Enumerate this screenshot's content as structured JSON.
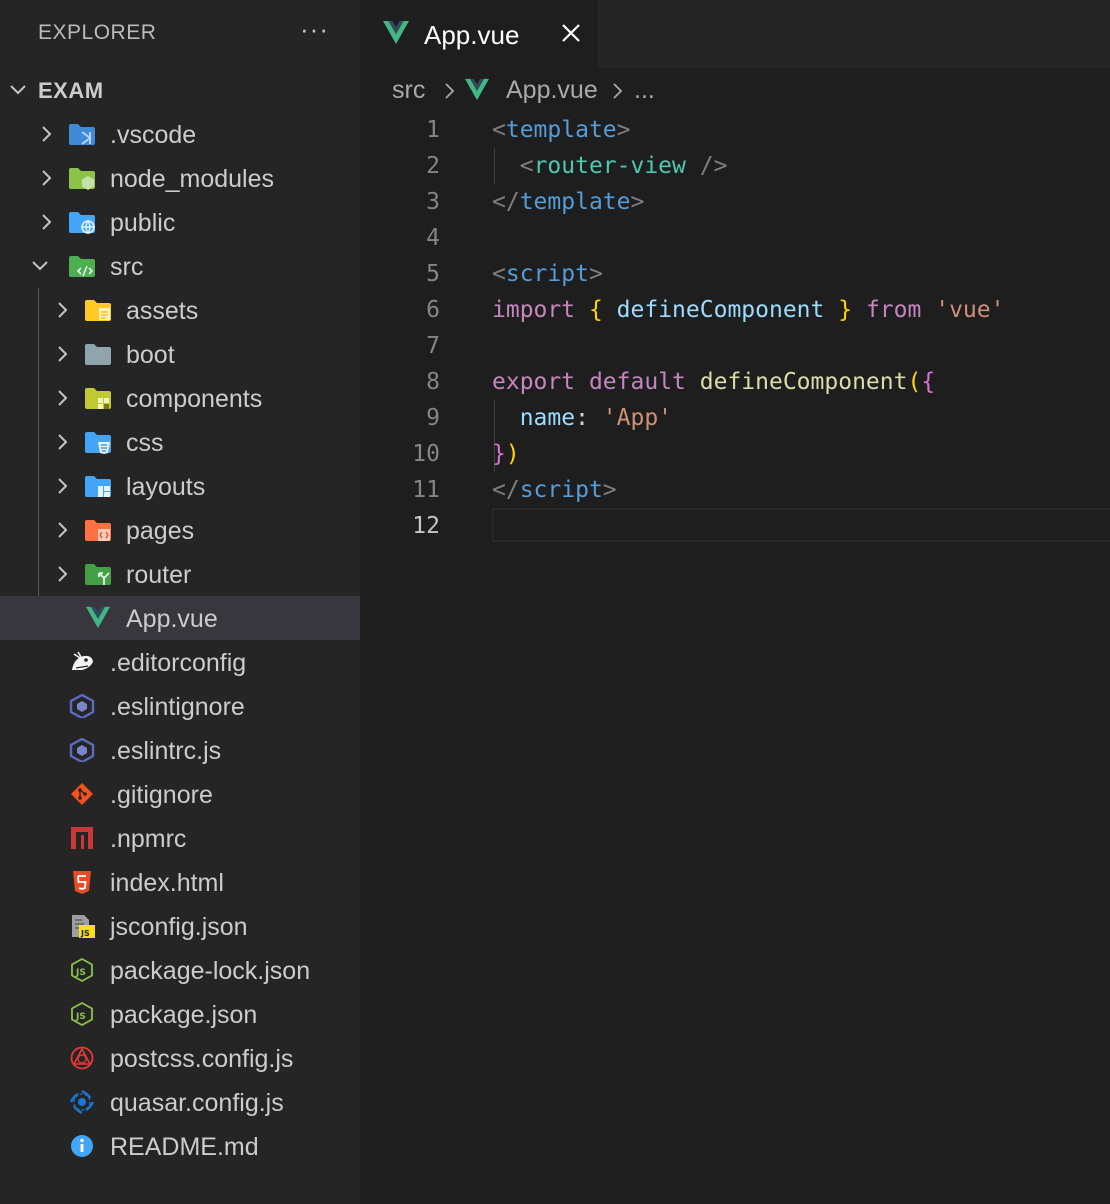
{
  "sidebar": {
    "title": "EXPLORER",
    "more": "···",
    "root": {
      "label": "EXAM",
      "expanded": true
    },
    "items": [
      {
        "label": ".vscode",
        "type": "folder",
        "icon": "vscode-folder-icon",
        "color": "#3f8ad6"
      },
      {
        "label": "node_modules",
        "type": "folder",
        "icon": "node-folder-icon",
        "color": "#8bc34a"
      },
      {
        "label": "public",
        "type": "folder",
        "icon": "public-folder-icon",
        "color": "#42a5f5"
      },
      {
        "label": "src",
        "type": "folder",
        "icon": "src-folder-icon",
        "color": "#4caf50",
        "expanded": true
      },
      {
        "label": "assets",
        "type": "folder",
        "icon": "assets-folder-icon",
        "color": "#ffca28"
      },
      {
        "label": "boot",
        "type": "folder",
        "icon": "boot-folder-icon",
        "color": "#90a4ae"
      },
      {
        "label": "components",
        "type": "folder",
        "icon": "components-folder-icon",
        "color": "#c0ca33"
      },
      {
        "label": "css",
        "type": "folder",
        "icon": "css-folder-icon",
        "color": "#42a5f5"
      },
      {
        "label": "layouts",
        "type": "folder",
        "icon": "layouts-folder-icon",
        "color": "#42a5f5"
      },
      {
        "label": "pages",
        "type": "folder",
        "icon": "pages-folder-icon",
        "color": "#ff7043"
      },
      {
        "label": "router",
        "type": "folder",
        "icon": "router-folder-icon",
        "color": "#43a047"
      },
      {
        "label": "App.vue",
        "type": "file",
        "icon": "vue-icon",
        "color": "#41b883",
        "selected": true
      },
      {
        "label": ".editorconfig",
        "type": "file",
        "icon": "editorconfig-icon",
        "color": "#ffffff"
      },
      {
        "label": ".eslintignore",
        "type": "file",
        "icon": "eslint-icon",
        "color": "#5c6bc0"
      },
      {
        "label": ".eslintrc.js",
        "type": "file",
        "icon": "eslint-icon",
        "color": "#5c6bc0"
      },
      {
        "label": ".gitignore",
        "type": "file",
        "icon": "git-icon",
        "color": "#f4511e"
      },
      {
        "label": ".npmrc",
        "type": "file",
        "icon": "npm-icon",
        "color": "#cb3837"
      },
      {
        "label": "index.html",
        "type": "file",
        "icon": "html-icon",
        "color": "#e44d26"
      },
      {
        "label": "jsconfig.json",
        "type": "file",
        "icon": "jsconfig-icon",
        "color": "#f7df1e"
      },
      {
        "label": "package-lock.json",
        "type": "file",
        "icon": "nodejs-icon",
        "color": "#8bc34a"
      },
      {
        "label": "package.json",
        "type": "file",
        "icon": "nodejs-icon",
        "color": "#8bc34a"
      },
      {
        "label": "postcss.config.js",
        "type": "file",
        "icon": "postcss-icon",
        "color": "#e53935"
      },
      {
        "label": "quasar.config.js",
        "type": "file",
        "icon": "quasar-icon",
        "color": "#1976d2"
      },
      {
        "label": "README.md",
        "type": "file",
        "icon": "info-icon",
        "color": "#42a5f5"
      }
    ]
  },
  "editor": {
    "tab": {
      "label": "App.vue",
      "icon": "vue-icon"
    },
    "breadcrumb": {
      "folder": "src",
      "file": "App.vue",
      "more": "..."
    },
    "active_line": 12,
    "lines": [
      {
        "n": "1",
        "tokens": [
          [
            "t-punc",
            "<"
          ],
          [
            "t-tag",
            "template"
          ],
          [
            "t-punc",
            ">"
          ]
        ]
      },
      {
        "n": "2",
        "tokens": [
          [
            "t-plain",
            "  "
          ],
          [
            "t-punc",
            "<"
          ],
          [
            "t-comp",
            "router-view"
          ],
          [
            "t-plain",
            " "
          ],
          [
            "t-punc",
            "/>"
          ]
        ]
      },
      {
        "n": "3",
        "tokens": [
          [
            "t-punc",
            "</"
          ],
          [
            "t-tag",
            "template"
          ],
          [
            "t-punc",
            ">"
          ]
        ]
      },
      {
        "n": "4",
        "tokens": []
      },
      {
        "n": "5",
        "tokens": [
          [
            "t-punc",
            "<"
          ],
          [
            "t-tag",
            "script"
          ],
          [
            "t-punc",
            ">"
          ]
        ]
      },
      {
        "n": "6",
        "tokens": [
          [
            "t-kw",
            "import"
          ],
          [
            "t-plain",
            " "
          ],
          [
            "t-brace1",
            "{"
          ],
          [
            "t-plain",
            " "
          ],
          [
            "t-var",
            "defineComponent"
          ],
          [
            "t-plain",
            " "
          ],
          [
            "t-brace1",
            "}"
          ],
          [
            "t-plain",
            " "
          ],
          [
            "t-kw",
            "from"
          ],
          [
            "t-plain",
            " "
          ],
          [
            "t-str",
            "'vue'"
          ]
        ]
      },
      {
        "n": "7",
        "tokens": []
      },
      {
        "n": "8",
        "tokens": [
          [
            "t-kw",
            "export"
          ],
          [
            "t-plain",
            " "
          ],
          [
            "t-kw",
            "default"
          ],
          [
            "t-plain",
            " "
          ],
          [
            "t-fn",
            "defineComponent"
          ],
          [
            "t-brace1",
            "("
          ],
          [
            "t-brace2",
            "{"
          ]
        ]
      },
      {
        "n": "9",
        "tokens": [
          [
            "t-plain",
            "  "
          ],
          [
            "t-var",
            "name"
          ],
          [
            "t-plain",
            ": "
          ],
          [
            "t-str",
            "'App'"
          ]
        ]
      },
      {
        "n": "10",
        "tokens": [
          [
            "t-brace2",
            "}"
          ],
          [
            "t-brace1",
            ")"
          ]
        ]
      },
      {
        "n": "11",
        "tokens": [
          [
            "t-punc",
            "</"
          ],
          [
            "t-tag",
            "script"
          ],
          [
            "t-punc",
            ">"
          ]
        ]
      },
      {
        "n": "12",
        "tokens": []
      }
    ]
  }
}
